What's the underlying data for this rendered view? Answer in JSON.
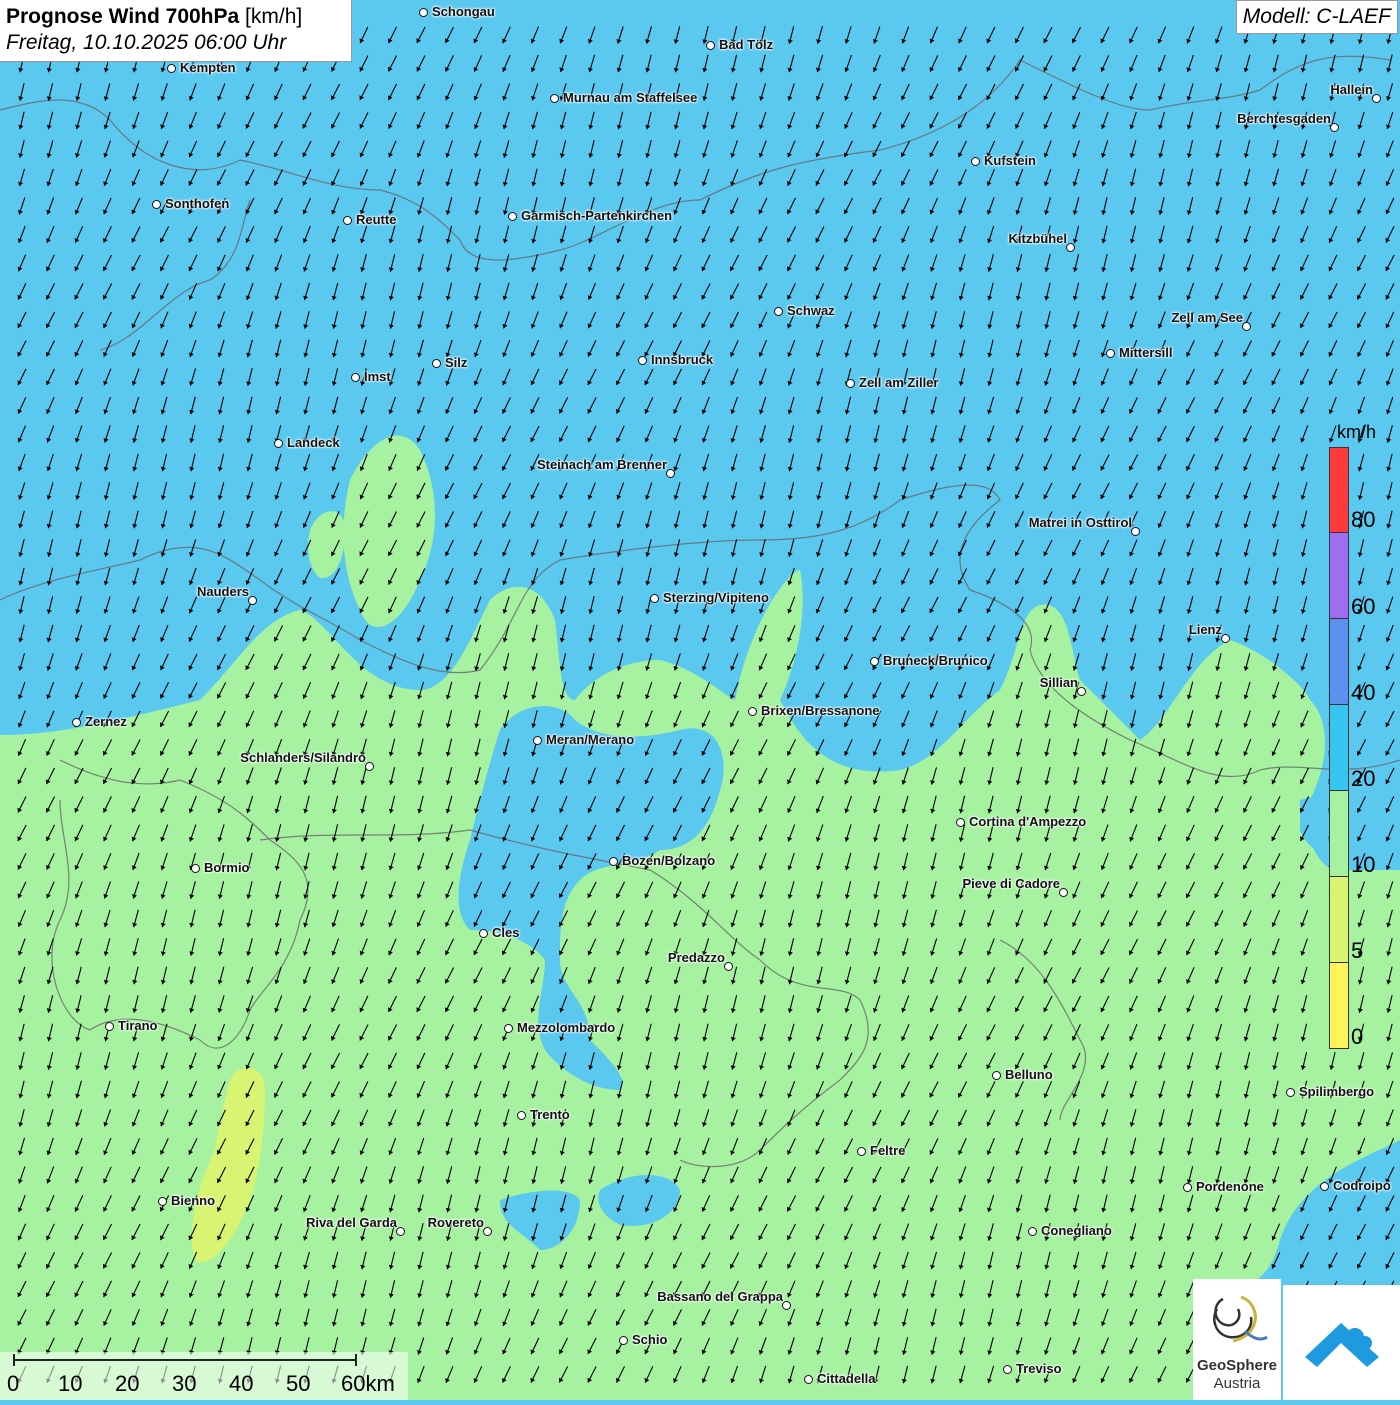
{
  "title": {
    "main": "Prognose Wind 700hPa",
    "unit": "[km/h]",
    "datetime": "Freitag, 10.10.2025 06:00 Uhr"
  },
  "model": "Modell: C-LAEF",
  "legend": {
    "unit": "km/h",
    "labels": [
      "80",
      "60",
      "40",
      "20",
      "10",
      "5",
      "0"
    ],
    "colors": [
      "#ff3a3a",
      "#a06cf0",
      "#5e90f0",
      "#36c4f0",
      "#a6f2a0",
      "#d8f472",
      "#fff25a"
    ]
  },
  "scale_bar": {
    "labels": [
      "0",
      "10",
      "20",
      "30",
      "40",
      "50",
      "60km"
    ]
  },
  "cities": [
    {
      "name": "Schongau"
    },
    {
      "name": "Bad Tölz"
    },
    {
      "name": "Kempten"
    },
    {
      "name": "Murnau am Staffelsee"
    },
    {
      "name": "Hallein"
    },
    {
      "name": "Berchtesgaden"
    },
    {
      "name": "Kufstein"
    },
    {
      "name": "Sonthofen"
    },
    {
      "name": "Reutte"
    },
    {
      "name": "Garmisch-Partenkirchen"
    },
    {
      "name": "Kitzbühel"
    },
    {
      "name": "Schwaz"
    },
    {
      "name": "Zell am See"
    },
    {
      "name": "Mittersill"
    },
    {
      "name": "Innsbruck"
    },
    {
      "name": "Silz"
    },
    {
      "name": "Imst"
    },
    {
      "name": "Zell am Ziller"
    },
    {
      "name": "Landeck"
    },
    {
      "name": "Steinach am Brenner"
    },
    {
      "name": "Matrei in Osttirol"
    },
    {
      "name": "Nauders"
    },
    {
      "name": "Sterzing/Vipiteno"
    },
    {
      "name": "Lienz"
    },
    {
      "name": "Bruneck/Brunico"
    },
    {
      "name": "Sillian"
    },
    {
      "name": "Zernez"
    },
    {
      "name": "Brixen/Bressanone"
    },
    {
      "name": "Meran/Merano"
    },
    {
      "name": "Schlanders/Silandro"
    },
    {
      "name": "Cortina d'Ampezzo"
    },
    {
      "name": "Bozen/Bolzano"
    },
    {
      "name": "Bormio"
    },
    {
      "name": "Pieve di Cadore"
    },
    {
      "name": "Cles"
    },
    {
      "name": "Predazzo"
    },
    {
      "name": "Tirano"
    },
    {
      "name": "Mezzolombardo"
    },
    {
      "name": "Belluno"
    },
    {
      "name": "Spilimbergo"
    },
    {
      "name": "Trento"
    },
    {
      "name": "Feltre"
    },
    {
      "name": "Pordenone"
    },
    {
      "name": "Codroipo"
    },
    {
      "name": "Bienno"
    },
    {
      "name": "Riva del Garda"
    },
    {
      "name": "Rovereto"
    },
    {
      "name": "Conegliano"
    },
    {
      "name": "Bassano del Grappa"
    },
    {
      "name": "Schio"
    },
    {
      "name": "Treviso"
    },
    {
      "name": "Cittadella"
    }
  ],
  "logos": {
    "geosphere_line1": "GeoSphere",
    "geosphere_line2": "Austria"
  }
}
